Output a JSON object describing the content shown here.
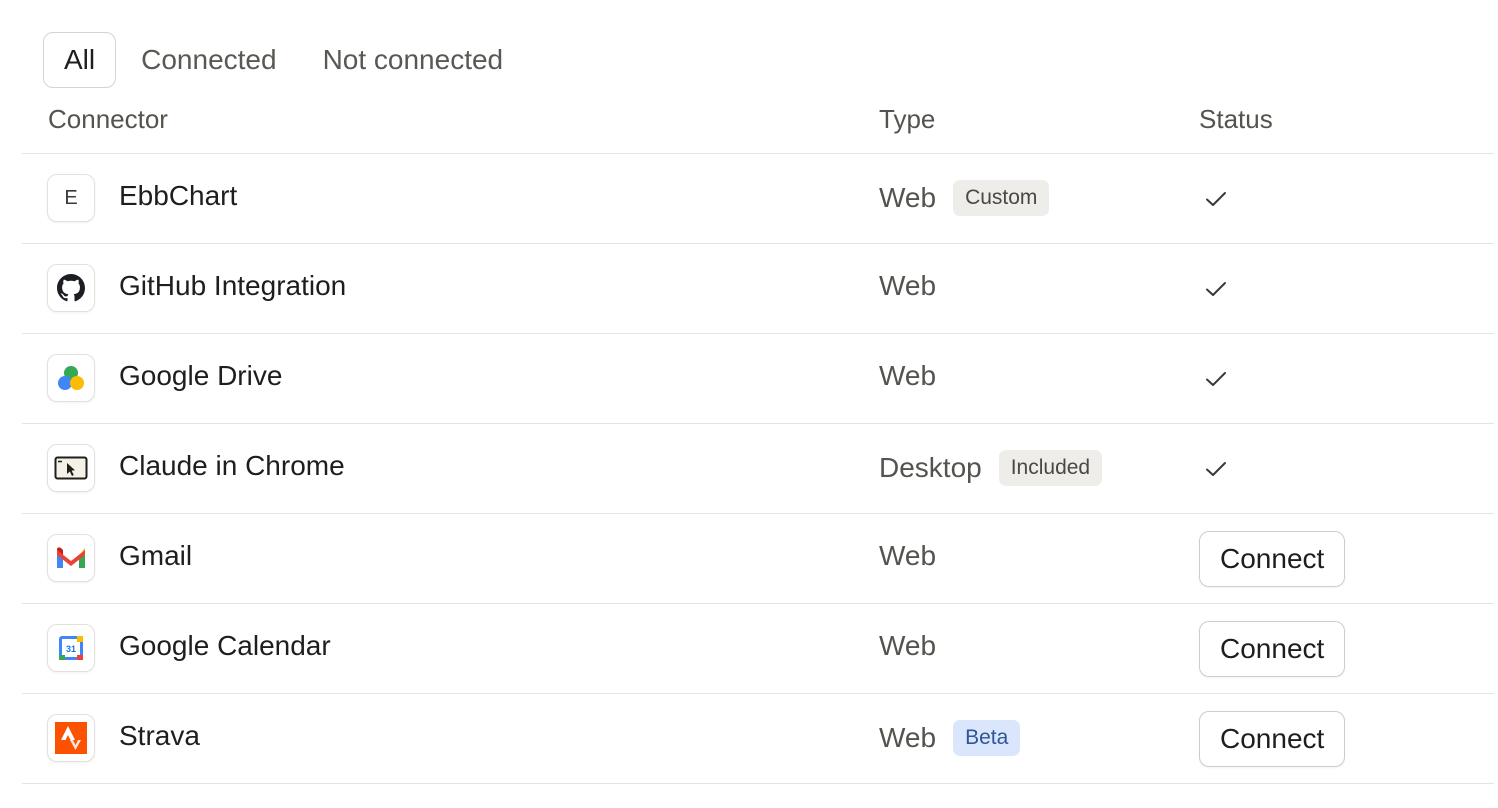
{
  "filters": [
    {
      "label": "All",
      "active": true
    },
    {
      "label": "Connected",
      "active": false
    },
    {
      "label": "Not connected",
      "active": false
    }
  ],
  "columns": {
    "connector": "Connector",
    "type": "Type",
    "status": "Status"
  },
  "rows": [
    {
      "name": "EbbChart",
      "logo_letter": "E",
      "icon": "ebbchart-logo-icon",
      "type": "Web",
      "badge": "Custom",
      "badge_style": "neutral",
      "connected": true
    },
    {
      "name": "GitHub Integration",
      "icon": "github-logo-icon",
      "type": "Web",
      "badge": "",
      "connected": true
    },
    {
      "name": "Google Drive",
      "icon": "google-drive-logo-icon",
      "type": "Web",
      "badge": "",
      "connected": true
    },
    {
      "name": "Claude in Chrome",
      "icon": "browser-cursor-icon",
      "type": "Desktop",
      "badge": "Included",
      "badge_style": "neutral",
      "connected": true
    },
    {
      "name": "Gmail",
      "icon": "gmail-logo-icon",
      "type": "Web",
      "badge": "",
      "connected": false,
      "action": "Connect"
    },
    {
      "name": "Google Calendar",
      "icon": "google-calendar-logo-icon",
      "calendar_day": "31",
      "type": "Web",
      "badge": "",
      "connected": false,
      "action": "Connect"
    },
    {
      "name": "Strava",
      "icon": "strava-logo-icon",
      "type": "Web",
      "badge": "Beta",
      "badge_style": "beta",
      "connected": false,
      "action": "Connect"
    }
  ],
  "colors": {
    "strava": "#fc5200",
    "gmail_red": "#ea4335",
    "google_blue": "#4285f4",
    "google_green": "#34a853",
    "google_yellow": "#fbbc04",
    "beta_badge_bg": "#d9e6fb"
  }
}
